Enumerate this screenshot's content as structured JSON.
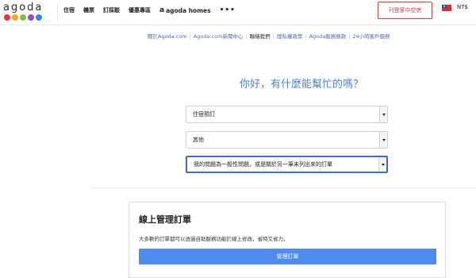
{
  "brand": {
    "logo_text": "agoda",
    "dot_colors": [
      "#e8353b",
      "#f6a623",
      "#7fbf3f",
      "#8c4bc9",
      "#3a85d6"
    ]
  },
  "nav": {
    "items": [
      "住宿",
      "機票",
      "訂採駁",
      "優惠專區"
    ],
    "homes_mark": "a",
    "homes_label": "agoda homes",
    "more_label": "•••"
  },
  "promo_label": "刊登家中空房",
  "currency": "NT$",
  "sublinks": [
    "關於Agoda.com",
    "Agoda.com新聞中心",
    "聯絡我們",
    "隱私權政策",
    "Agoda服務條款",
    "24小時客戶服務"
  ],
  "help_title": "你好，有什麼能幫忙的嗎？",
  "selects": [
    {
      "value": "住宿預訂"
    },
    {
      "value": "其他"
    },
    {
      "value": "我的問題為一般性問題，或是關於另一筆未列出來的訂單"
    }
  ],
  "manage": {
    "title": "線上管理訂單",
    "desc": "大多數的訂單都可以透過自助服務功能於線上修改，省時又省力。",
    "button": "管理訂單"
  },
  "colors": {
    "link": "#4a6fb3",
    "title": "#4a86c5",
    "button": "#4e8ced",
    "promo": "#d93b3b"
  }
}
